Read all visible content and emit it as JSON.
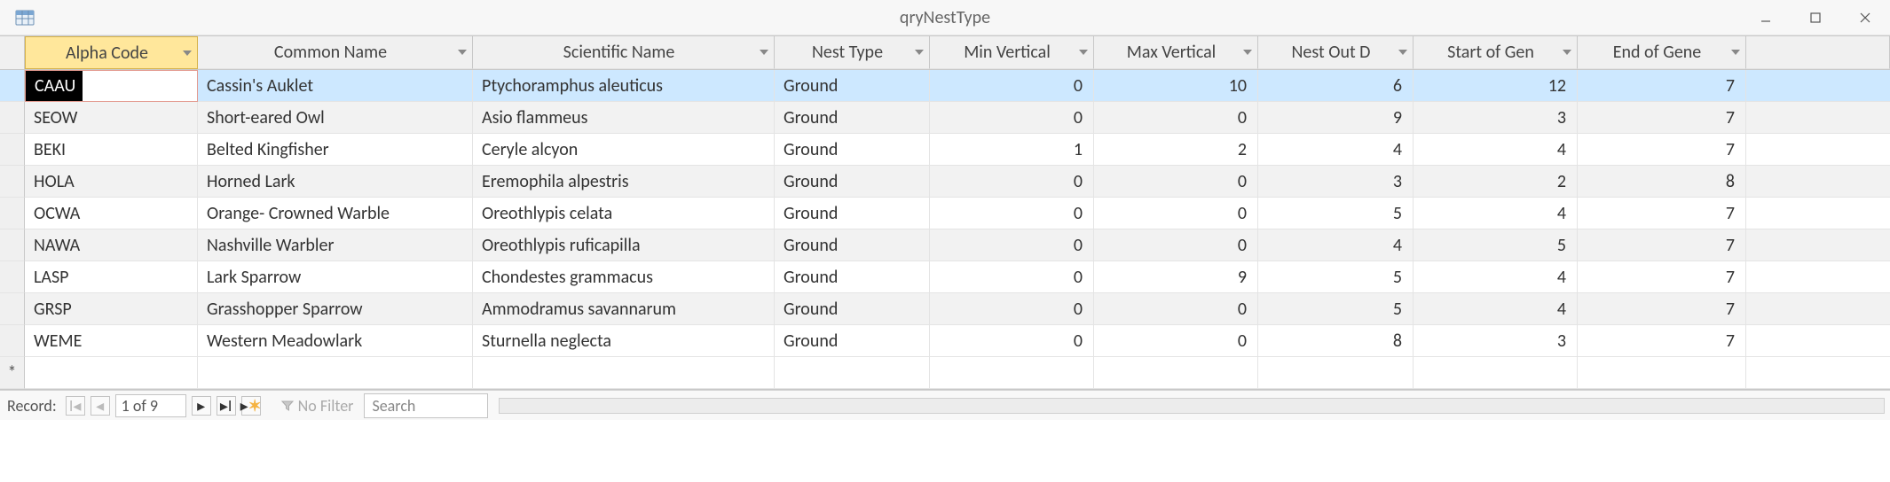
{
  "window": {
    "title": "qryNestType"
  },
  "columns": [
    {
      "key": "alpha",
      "label": "Alpha Code",
      "active": true
    },
    {
      "key": "common",
      "label": "Common Name"
    },
    {
      "key": "sci",
      "label": "Scientific Name"
    },
    {
      "key": "nest",
      "label": "Nest Type"
    },
    {
      "key": "minv",
      "label": "Min Vertical"
    },
    {
      "key": "maxv",
      "label": "Max Vertical"
    },
    {
      "key": "nod",
      "label": "Nest Out D"
    },
    {
      "key": "sgen",
      "label": "Start of Gen"
    },
    {
      "key": "egen",
      "label": "End of Gene"
    }
  ],
  "rows": [
    {
      "alpha": "CAAU",
      "common": "Cassin's Auklet",
      "sci": "Ptychoramphus aleuticus",
      "nest": "Ground",
      "minv": 0,
      "maxv": 10,
      "nod": 6,
      "sgen": 12,
      "egen": 7,
      "selected": true,
      "editing": true
    },
    {
      "alpha": "SEOW",
      "common": "Short-eared Owl",
      "sci": "Asio flammeus",
      "nest": "Ground",
      "minv": 0,
      "maxv": 0,
      "nod": 9,
      "sgen": 3,
      "egen": 7
    },
    {
      "alpha": "BEKI",
      "common": "Belted Kingfisher",
      "sci": "Ceryle alcyon",
      "nest": "Ground",
      "minv": 1,
      "maxv": 2,
      "nod": 4,
      "sgen": 4,
      "egen": 7
    },
    {
      "alpha": "HOLA",
      "common": "Horned Lark",
      "sci": "Eremophila alpestris",
      "nest": "Ground",
      "minv": 0,
      "maxv": 0,
      "nod": 3,
      "sgen": 2,
      "egen": 8
    },
    {
      "alpha": "OCWA",
      "common": "Orange- Crowned Warble",
      "sci": "Oreothlypis celata",
      "nest": "Ground",
      "minv": 0,
      "maxv": 0,
      "nod": 5,
      "sgen": 4,
      "egen": 7
    },
    {
      "alpha": "NAWA",
      "common": "Nashville Warbler",
      "sci": "Oreothlypis ruficapilla",
      "nest": "Ground",
      "minv": 0,
      "maxv": 0,
      "nod": 4,
      "sgen": 5,
      "egen": 7
    },
    {
      "alpha": "LASP",
      "common": "Lark Sparrow",
      "sci": "Chondestes grammacus",
      "nest": "Ground",
      "minv": 0,
      "maxv": 9,
      "nod": 5,
      "sgen": 4,
      "egen": 7
    },
    {
      "alpha": "GRSP",
      "common": "Grasshopper Sparrow",
      "sci": "Ammodramus savannarum",
      "nest": "Ground",
      "minv": 0,
      "maxv": 0,
      "nod": 5,
      "sgen": 4,
      "egen": 7
    },
    {
      "alpha": "WEME",
      "common": "Western Meadowlark",
      "sci": "Sturnella neglecta",
      "nest": "Ground",
      "minv": 0,
      "maxv": 0,
      "nod": 8,
      "sgen": 3,
      "egen": 7
    }
  ],
  "newrow_marker": "*",
  "recordnav": {
    "label": "Record:",
    "current": "1 of 9",
    "no_filter": "No Filter",
    "search_placeholder": "Search"
  }
}
